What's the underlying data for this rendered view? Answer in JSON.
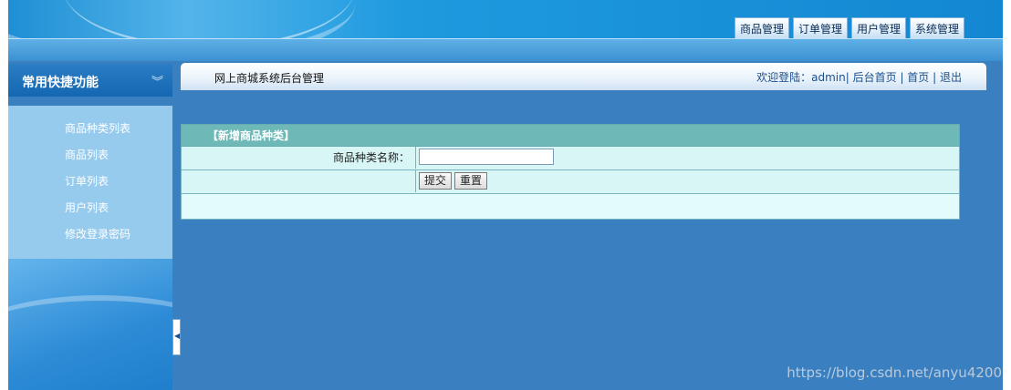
{
  "header": {
    "nav": [
      "商品管理",
      "订单管理",
      "用户管理",
      "系统管理"
    ]
  },
  "sidebar": {
    "title": "常用快捷功能",
    "toggle_icon": "double-chevron-down-icon",
    "items": [
      "商品种类列表",
      "商品列表",
      "订单列表",
      "用户列表",
      "修改登录密码"
    ]
  },
  "breadcrumb": {
    "title": "网上商城系统后台管理",
    "welcome": "欢迎登陆：",
    "user": "admin",
    "sep1": "| ",
    "home_admin": "后台首页",
    "sep2": " | ",
    "home": "首页",
    "sep3": " | ",
    "logout": "退出"
  },
  "form": {
    "title": "【新增商品种类】",
    "name_label": "商品种类名称：",
    "name_value": "",
    "submit_label": "提交",
    "reset_label": "重置"
  },
  "watermark": "https://blog.csdn.net/anyu4200"
}
